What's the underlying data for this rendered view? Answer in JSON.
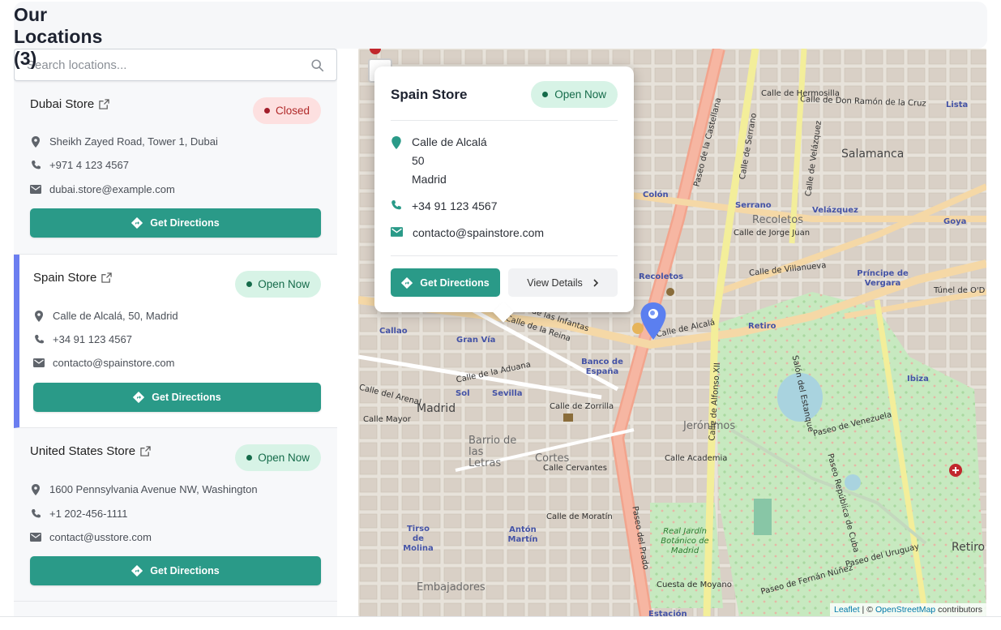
{
  "page": {
    "title": "Our Locations (3)"
  },
  "search": {
    "placeholder": "Search locations..."
  },
  "locations": [
    {
      "name": "Dubai Store",
      "status": "Closed",
      "address": "Sheikh Zayed Road, Tower 1, Dubai",
      "phone": "+971 4 123 4567",
      "email": "dubai.store@example.com",
      "button": "Get Directions"
    },
    {
      "name": "Spain Store",
      "status": "Open Now",
      "address": "Calle de Alcalá, 50, Madrid",
      "phone": "+34 91 123 4567",
      "email": "contacto@spainstore.com",
      "button": "Get Directions"
    },
    {
      "name": "United States Store",
      "status": "Open Now",
      "address": "1600 Pennsylvania Avenue NW, Washington",
      "phone": "+1 202-456-1111",
      "email": "contact@usstore.com",
      "button": "Get Directions"
    }
  ],
  "popup": {
    "title": "Spain Store",
    "status": "Open Now",
    "address_line1": "Calle de Alcalá",
    "address_line2": "50",
    "address_line3": "Madrid",
    "phone": "+34 91 123 4567",
    "email": "contacto@spainstore.com",
    "directions_label": "Get Directions",
    "details_label": "View Details"
  },
  "map": {
    "zoom_symbol": "-",
    "attribution_leaflet": "Leaflet",
    "attribution_sep": "|",
    "attribution_copy": "©",
    "attribution_osm": "OpenStreetMap",
    "attribution_suffix": "contributors",
    "labels": {
      "salamanca": "Salamanca",
      "recoletos": "Recoletos",
      "madrid": "Madrid",
      "jeronimos": "Jerónimos",
      "cortes": "Cortes",
      "barrio": "Barrio de las Letras",
      "embajadores": "Embajadores",
      "retiro": "Retiro",
      "colon": "Colón",
      "serrano": "Serrano",
      "velazquez": "Velázquez",
      "goya": "Goya",
      "principe": "Príncipe de Vergara",
      "recoletos_metro": "Recoletos",
      "retiro_metro": "Retiro",
      "banco": "Banco de España",
      "gran_via": "Gran Vía",
      "sol": "Sol",
      "sevilla": "Sevilla",
      "callao": "Callao",
      "ibiza": "Ibiza",
      "anton_martin": "Antón Martín",
      "tirso": "Tirso de Molina",
      "lista": "Lista",
      "estacion": "Estación",
      "calle_alcala": "Calle de Alcalá",
      "paseo_castellana": "Paseo de la Castellana",
      "paseo_prado": "Paseo del Prado",
      "calle_serrano": "Calle de Serrano",
      "calle_velazquez": "Calle de Velázquez",
      "calle_alfonso": "Calle de Alfonso XII",
      "tunel": "Túnel de O'D",
      "jardin": "Real Jardín Botánico de Madrid",
      "paseo_venezuela": "Paseo de Venezuela",
      "paseo_cuba": "Paseo República de Cuba",
      "paseo_uruguay": "Paseo del Uruguay",
      "paseo_fernan": "Paseo de Fernán Núñez",
      "calle_jorge_juan": "Calle de Jorge Juan",
      "calle_villanueva": "Calle de Villanueva",
      "calle_moratin": "Calle de Moratín",
      "calle_cervantes": "Calle Cervantes",
      "calle_zorrilla": "Calle de Zorrilla",
      "calle_mayor": "Calle Mayor",
      "calle_academia": "Calle Academia",
      "cuesta_moyano": "Cuesta de Moyano",
      "calle_aduana": "Calle de la Aduana",
      "calle_arenal": "Calle del Arenal",
      "calle_reina": "Calle de la Reina",
      "calle_infantas": "Calle de las Infantas",
      "calle_don_ramon": "Calle de Don Ramón de la Cruz",
      "calle_hermosilla": "Calle de Hermosilla",
      "salon_estanque": "Salón del Estanque"
    }
  },
  "colors": {
    "accent": "#2a9a88",
    "active_border": "#6b7ef0",
    "open_bg": "#d7f3e6",
    "open_text": "#156b4a",
    "closed_bg": "#fde0e0",
    "closed_text": "#b02828",
    "marker": "#5b7ff0"
  },
  "icons": [
    "search-icon",
    "external-link-icon",
    "location-pin-icon",
    "phone-icon",
    "mail-icon",
    "directions-icon",
    "chevron-right-icon",
    "map-marker-icon"
  ]
}
